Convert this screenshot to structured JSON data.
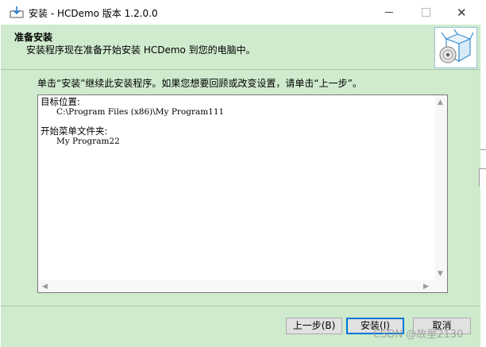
{
  "window": {
    "title": "安装 - HCDemo 版本 1.2.0.0"
  },
  "header": {
    "title": "准备安装",
    "subtitle": "安装程序现在准备开始安装 HCDemo 到您的电脑中。"
  },
  "main": {
    "instruction": "单击“安装”继续此安装程序。如果您想要回顾或改变设置，请单击“上一步”。",
    "memo": {
      "dest_label": "目标位置:",
      "dest_value": "C:\\Program Files (x86)\\My Program111",
      "start_menu_label": "开始菜单文件夹:",
      "start_menu_value": "My Program22"
    }
  },
  "buttons": {
    "back": "上一步(B)",
    "install": "安装(I)",
    "cancel": "取消"
  },
  "watermark": "CSDN @故里2130",
  "colors": {
    "window_bg": "#cfeacd",
    "title_bg": "#ffffff",
    "focus_border": "#0078d7"
  },
  "icons": [
    "installer-icon",
    "minimize-icon",
    "maximize-icon",
    "close-icon",
    "install-box-icon"
  ]
}
